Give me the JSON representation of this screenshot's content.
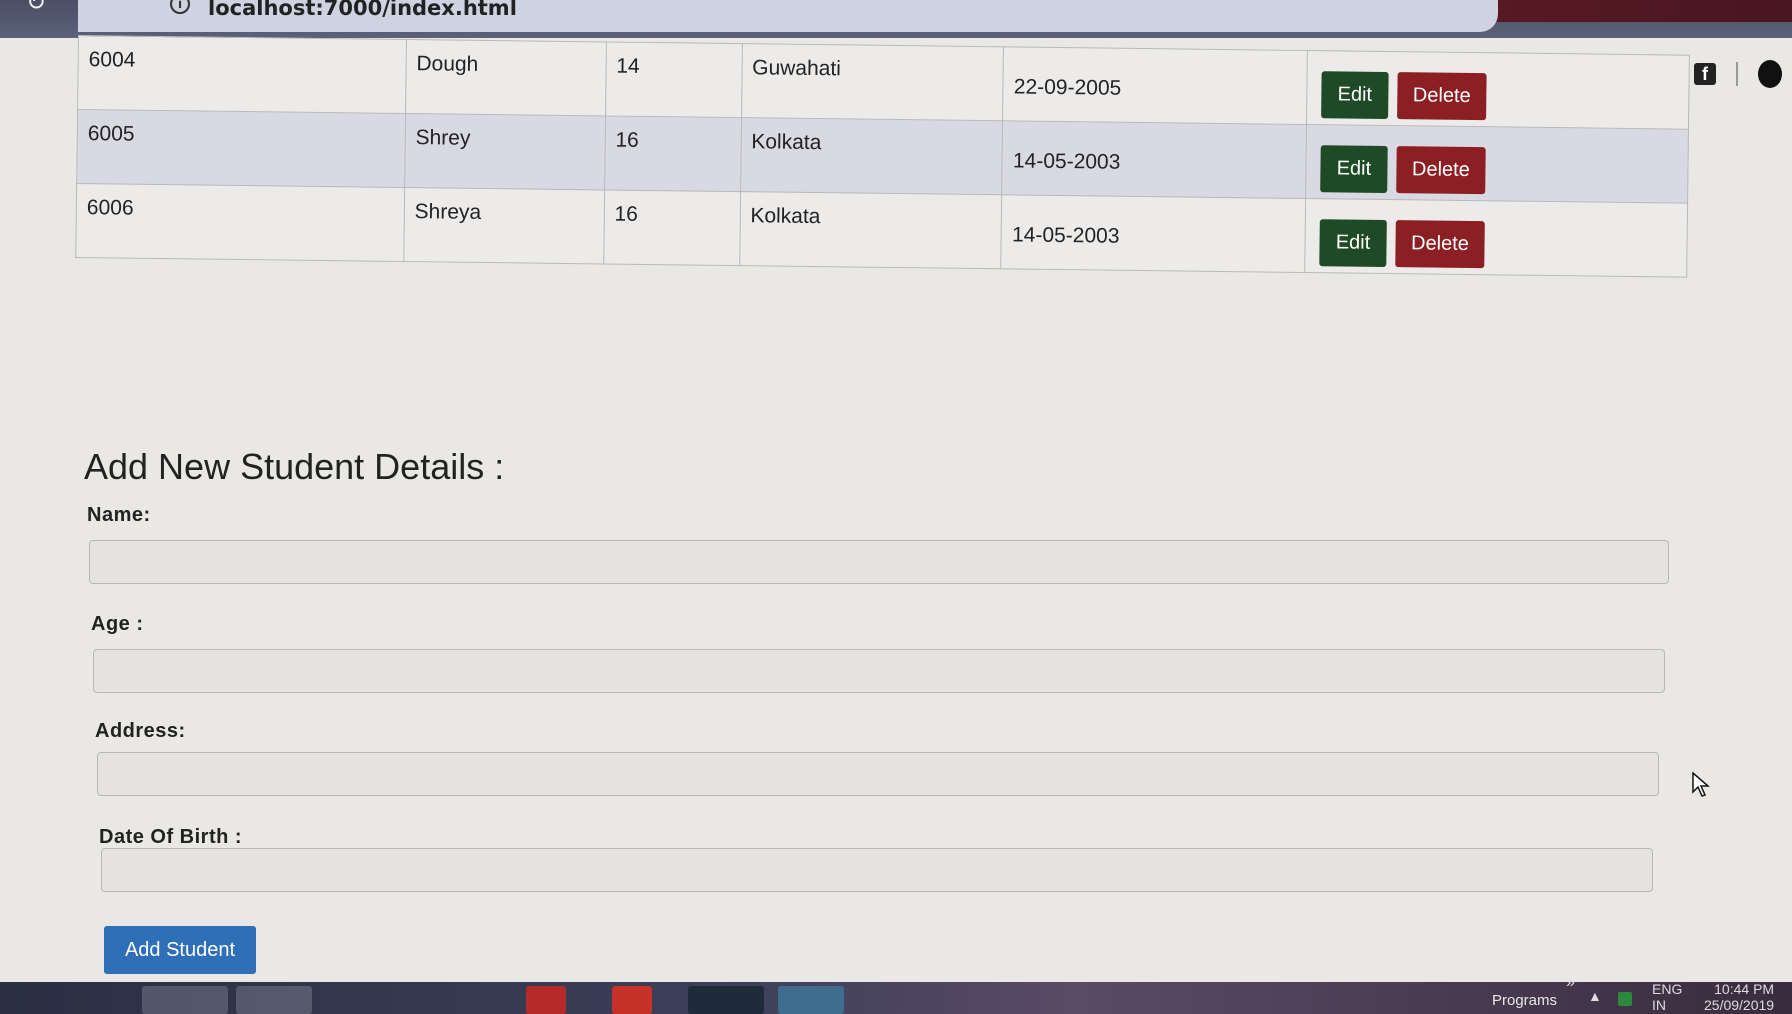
{
  "browser": {
    "url": "localhost:7000/index.html",
    "icons": [
      "reload-icon",
      "info-icon",
      "star-icon",
      "extension-icon",
      "facebook-icon",
      "avatar-icon"
    ]
  },
  "table": {
    "rows": [
      {
        "id": "6004",
        "name": "Dough",
        "age": "14",
        "address": "Guwahati",
        "dob": "22-09-2005",
        "edit": "Edit",
        "delete": "Delete"
      },
      {
        "id": "6005",
        "name": "Shrey",
        "age": "16",
        "address": "Kolkata",
        "dob": "14-05-2003",
        "edit": "Edit",
        "delete": "Delete"
      },
      {
        "id": "6006",
        "name": "Shreya",
        "age": "16",
        "address": "Kolkata",
        "dob": "14-05-2003",
        "edit": "Edit",
        "delete": "Delete"
      }
    ]
  },
  "form": {
    "title": "Add New Student Details :",
    "name_label": "Name:",
    "name_value": "",
    "age_label": "Age :",
    "age_value": "",
    "address_label": "Address:",
    "address_value": "",
    "dob_label": "Date Of Birth :",
    "dob_value": "",
    "submit_label": "Add Student"
  },
  "taskbar": {
    "programs": "Programs",
    "chevron": "»",
    "tray_arrow": "▲",
    "lang_line1": "ENG",
    "lang_line2": "IN",
    "time": "10:44 PM",
    "date": "25/09/2019"
  },
  "colors": {
    "edit": "#1e4a25",
    "delete": "#8c1f24",
    "primary": "#2f6fb7",
    "row_alt": "#d8d9e3"
  }
}
